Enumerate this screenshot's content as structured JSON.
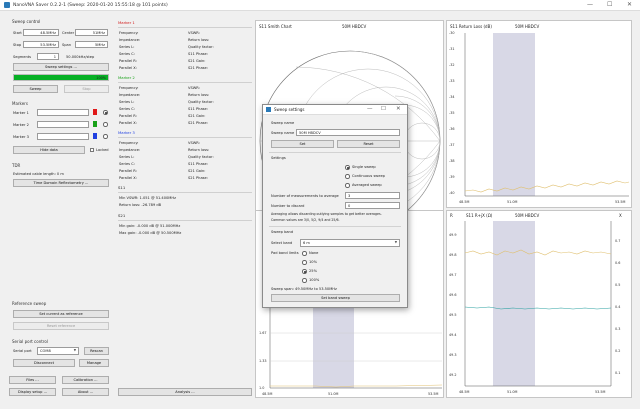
{
  "window": {
    "title": "NanoVNA Saver 0.2.2-1 (Sweep: 2020-01-20 15:55:18 @ 101 points)",
    "minimize": "—",
    "maximize": "☐",
    "close": "✕"
  },
  "sweep_control": {
    "title": "Sweep control",
    "start_label": "Start",
    "start_value": "48.5MHz",
    "center_label": "Center",
    "center_value": "51MHz",
    "stop_label": "Stop",
    "stop_value": "53.5MHz",
    "span_label": "Span",
    "span_value": "5MHz",
    "segments_label": "Segments",
    "segments_value": "1",
    "step_text": "50.000kHz/step",
    "settings_button": "Sweep settings ...",
    "progress_percent": 100,
    "progress_text": "100%",
    "sweep_button": "Sweep",
    "stop_button": "Stop"
  },
  "markers": {
    "title": "Markers",
    "marker1": "Marker 1",
    "marker2": "Marker 2",
    "marker3": "Marker 3",
    "marker1_color": "#e01818",
    "marker2_color": "#18a018",
    "marker3_color": "#2040e0",
    "hide_data": "Hide data",
    "locked": "Locked"
  },
  "tdr": {
    "title": "TDR",
    "cable_length": "Estimated cable length:  0 m",
    "button": "Time Domain Reflectometry ..."
  },
  "reference_sweep": {
    "title": "Reference sweep",
    "set_current": "Set current as reference",
    "reset": "Reset reference"
  },
  "serial": {
    "title": "Serial port control",
    "port_label": "Serial port",
    "port_value": "COM8",
    "rescan": "Rescan",
    "disconnect": "Disconnect",
    "manage": "Manage"
  },
  "bottom_buttons": {
    "files": "Files ...",
    "calibration": "Calibration ...",
    "display_setup": "Display setup ...",
    "about": "About ...",
    "analysis": "Analysis ..."
  },
  "marker_details": {
    "m1_title": "Marker 1",
    "m2_title": "Marker 2",
    "m3_title": "Marker 3",
    "m1_color": "#d01818",
    "m2_color": "#18a018",
    "m3_color": "#2040e0",
    "frequency": "Frequency:",
    "impedance": "Impedance:",
    "series_l": "Series L:",
    "series_c": "Series C:",
    "parallel_r": "Parallel R:",
    "parallel_x": "Parallel X:",
    "vswr": "VSWR:",
    "return_loss": "Return loss:",
    "quality_factor": "Quality factor:",
    "s11_phase": "S11 Phase:",
    "s21_gain": "S21 Gain:",
    "s21_phase": "S21 Phase:",
    "s11_title": "S11",
    "s11_min_vswr": "Min VSWR:     1.051 @ 51.400MHz",
    "s11_return_loss": "Return loss:    -26.789 dB",
    "s21_title": "S21",
    "s21_min_gain": "Min gain:   -0.000 dB @ 51.000MHz",
    "s21_max_gain": "Max gain:   -0.000 dB @ 50.500MHz"
  },
  "charts": {
    "smith_title": "S11 Smith Chart",
    "smith_label": "50M HBDCV",
    "return_loss_title": "S11 Return Loss (dB)",
    "return_loss_label": "50M HBDCV",
    "rl_ticks": [
      "-30",
      "-31",
      "-32",
      "-33",
      "-34",
      "-35",
      "-36",
      "-37",
      "-38",
      "-39",
      "-40"
    ],
    "rl_x_ticks": [
      "48.5M",
      "51.0M",
      "53.5M"
    ],
    "rx_title": "S11 R+jX (Ω)",
    "rx_label": "50M HBDCV",
    "rx_left_ticks": [
      "49.9",
      "49.8",
      "49.7",
      "49.6",
      "49.5",
      "49.4",
      "49.3",
      "49.2"
    ],
    "rx_right_ticks": [
      "0.7",
      "0.6",
      "0.5",
      "0.4",
      "0.3",
      "0.2",
      "0.1"
    ],
    "rx_x_ticks": [
      "48.5M",
      "51.0M",
      "53.5M"
    ],
    "rx_left_axis": "R",
    "rx_right_axis": "X",
    "lower_left_ticks": [
      "1.67",
      "1.33",
      "1.0"
    ],
    "lower_left_x_ticks": [
      "48.5M",
      "51.0M",
      "53.5M"
    ],
    "accent_curve": "#e0c070",
    "accent_teal": "#2aa0a0",
    "band_shade": "#d8d8e6"
  },
  "dialog": {
    "title": "Sweep settings",
    "sweep_name_section": "Sweep name",
    "sweep_name_label": "Sweep name",
    "sweep_name_value": "50M HBDCV",
    "set_button": "Set",
    "reset_button": "Reset",
    "settings_section": "Settings",
    "single_sweep": "Single sweep",
    "continuous_sweep": "Continuous sweep",
    "averaged_sweep": "Averaged sweep",
    "num_average_label": "Number of measurements to average",
    "num_average_value": "3",
    "num_discard_label": "Number to discard",
    "num_discard_value": "0",
    "averaging_note_1": "Averaging allows discarding outlying samples to get better averages.",
    "averaging_note_2": "Common values are 3/0, 5/2, 9/4 and 25/6.",
    "sweep_band_section": "Sweep band",
    "select_band_label": "Select band",
    "select_band_value": "6 m",
    "pad_band_label": "Pad band limits",
    "pad_none": "None",
    "pad_10": "10%",
    "pad_25": "25%",
    "pad_100": "100%",
    "sweep_span_text": "Sweep span: 49.50MHz to 53.50MHz",
    "set_band_button": "Set band sweep"
  }
}
